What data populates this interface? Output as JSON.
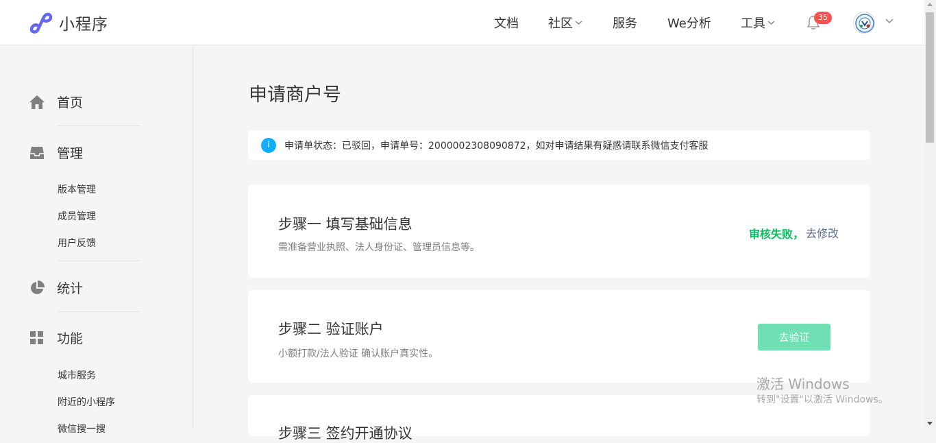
{
  "app": {
    "logo_text": "小程序"
  },
  "nav": {
    "docs": "文档",
    "community": "社区",
    "service": "服务",
    "we_analysis": "We分析",
    "tools": "工具",
    "badge_count": "35"
  },
  "sidebar": {
    "home": "首页",
    "manage": "管理",
    "manage_items": [
      "版本管理",
      "成员管理",
      "用户反馈"
    ],
    "stats": "统计",
    "features": "功能",
    "feature_items": [
      "城市服务",
      "附近的小程序",
      "微信搜一搜"
    ]
  },
  "main": {
    "title": "申请商户号",
    "notice": "申请单状态：已驳回，申请单号：2000002308090872，如对申请结果有疑惑请联系微信支付客服",
    "steps": [
      {
        "title": "步骤一 填写基础信息",
        "desc": "需准备营业执照、法人身份证、管理员信息等。",
        "status": "审核失败，",
        "action": "去修改"
      },
      {
        "title": "步骤二 验证账户",
        "desc": "小额打款/法人验证 确认账户真实性。",
        "action": "去验证"
      },
      {
        "title": "步骤三 签约开通协议"
      }
    ]
  },
  "watermark": {
    "line1": "激活 Windows",
    "line2": "转到\"设置\"以激活 Windows。"
  },
  "colors": {
    "accent_green": "#07c160",
    "link_blue": "#576b95",
    "info_blue": "#10aeff",
    "badge_red": "#fa5151",
    "verify_button": "#6fdfb4"
  },
  "icons": {
    "logo": "mini-program-logo-icon",
    "home": "home-icon",
    "manage": "inbox-icon",
    "stats": "pie-chart-icon",
    "features": "grid-icon",
    "bell": "bell-icon",
    "info": "info-icon"
  }
}
